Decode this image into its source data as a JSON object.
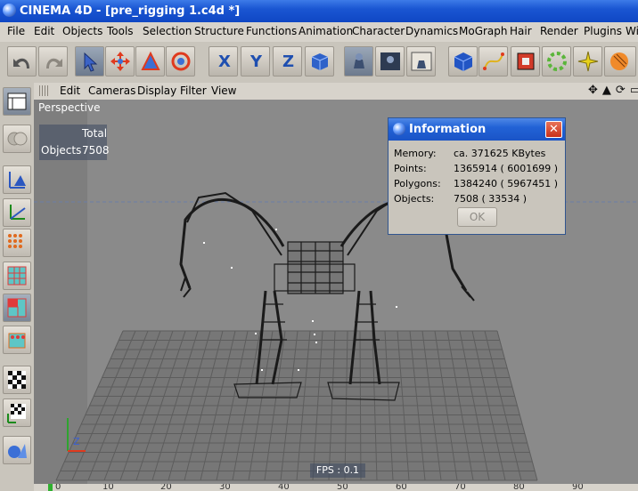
{
  "window": {
    "title": "CINEMA 4D - [pre_rigging 1.c4d *]"
  },
  "menu": [
    "File",
    "Edit",
    "Objects",
    "Tools",
    "Selection",
    "Structure",
    "Functions",
    "Animation",
    "Character",
    "Dynamics",
    "MoGraph",
    "Hair",
    "Render",
    "Plugins",
    "Wi"
  ],
  "toolbar": {
    "axis_x": "X",
    "axis_y": "Y",
    "axis_z": "Z"
  },
  "viewport_menu": [
    "Edit",
    "Cameras",
    "Display",
    "Filter",
    "View"
  ],
  "viewport": {
    "label": "Perspective",
    "stats_header": "Total",
    "stats_label": "Objects",
    "stats_value": "7508",
    "fps": "FPS : 0.1"
  },
  "info_dialog": {
    "title": "Information",
    "close": "✕",
    "rows": [
      {
        "key": "Memory:",
        "value": "ca. 371625 KBytes"
      },
      {
        "key": "Points:",
        "value": "1365914 ( 6001699 )"
      },
      {
        "key": "Polygons:",
        "value": "1384240 ( 5967451 )"
      },
      {
        "key": "Objects:",
        "value": "7508 ( 33534 )"
      }
    ],
    "ok": "OK"
  },
  "timeline": {
    "ticks": [
      "0",
      "10",
      "20",
      "30",
      "40",
      "50",
      "60",
      "70",
      "80",
      "90"
    ]
  },
  "colors": {
    "titlebar": "#1a56d2",
    "viewport_bg": "#8a8a8a",
    "grid": "#6e6e6e",
    "wire": "#1a1a1a"
  }
}
